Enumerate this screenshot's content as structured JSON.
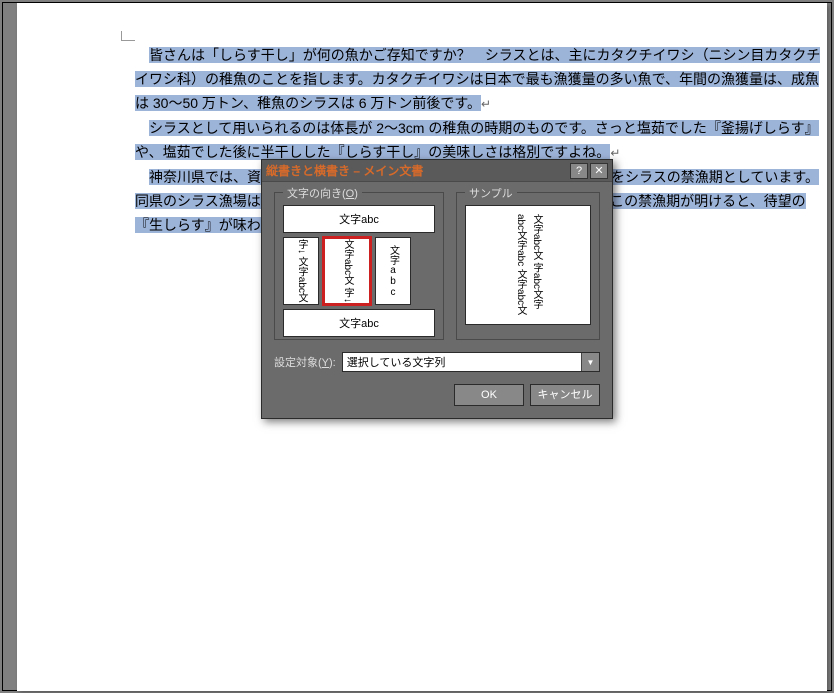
{
  "document": {
    "paragraphs": [
      "皆さんは「しらす干し」が何の魚かご存知ですか？　シラスとは、主にカタクチイワシ（ニシン目カタクチイワシ科）の稚魚のことを指します。カタクチイワシは日本で最も漁獲量の多い魚で、年間の漁獲量は、成魚は 30〜50 万トン、稚魚のシラスは 6 万トン前後です。",
      "シラスとして用いられるのは体長が 2〜3cm の稚魚の時期のものです。さっと塩茹でした『釜揚げしらす』や、塩茹でした後に半干しした『しらす干し』の美味しさは格別ですよね。",
      "神奈川県では、資源保護のため、毎年 1 月 1 日から 3 月 10 日までの期間をシラスの禁漁期としています。同県のシラス漁場は、相模湾の小田原市から大磯町から横須賀市長井まで。この禁漁期が明けると、待望の『生しらす』が味わえるようになります。"
    ]
  },
  "dialog": {
    "title": "縦書きと横書き – メイン文書",
    "help_btn": "?",
    "close_btn": "✕",
    "orientation_legend_prefix": "文字の向き(",
    "orientation_legend_accel": "O",
    "orientation_legend_suffix": ")",
    "sample_legend": "サンプル",
    "orient_top": "文字abc",
    "orient_mid_left": "字↓\n文字abc文",
    "orient_mid_center": "文字abc文\n字↓",
    "orient_mid_right": "文字abc",
    "orient_bot": "文字abc",
    "sample_lines": "文字abc文\n字abc文字\nabc文字abc\n文字abc文",
    "target_label_prefix": "設定対象(",
    "target_label_accel": "Y",
    "target_label_suffix": "):",
    "target_value": "選択している文字列",
    "ok": "OK",
    "cancel": "キャンセル"
  }
}
